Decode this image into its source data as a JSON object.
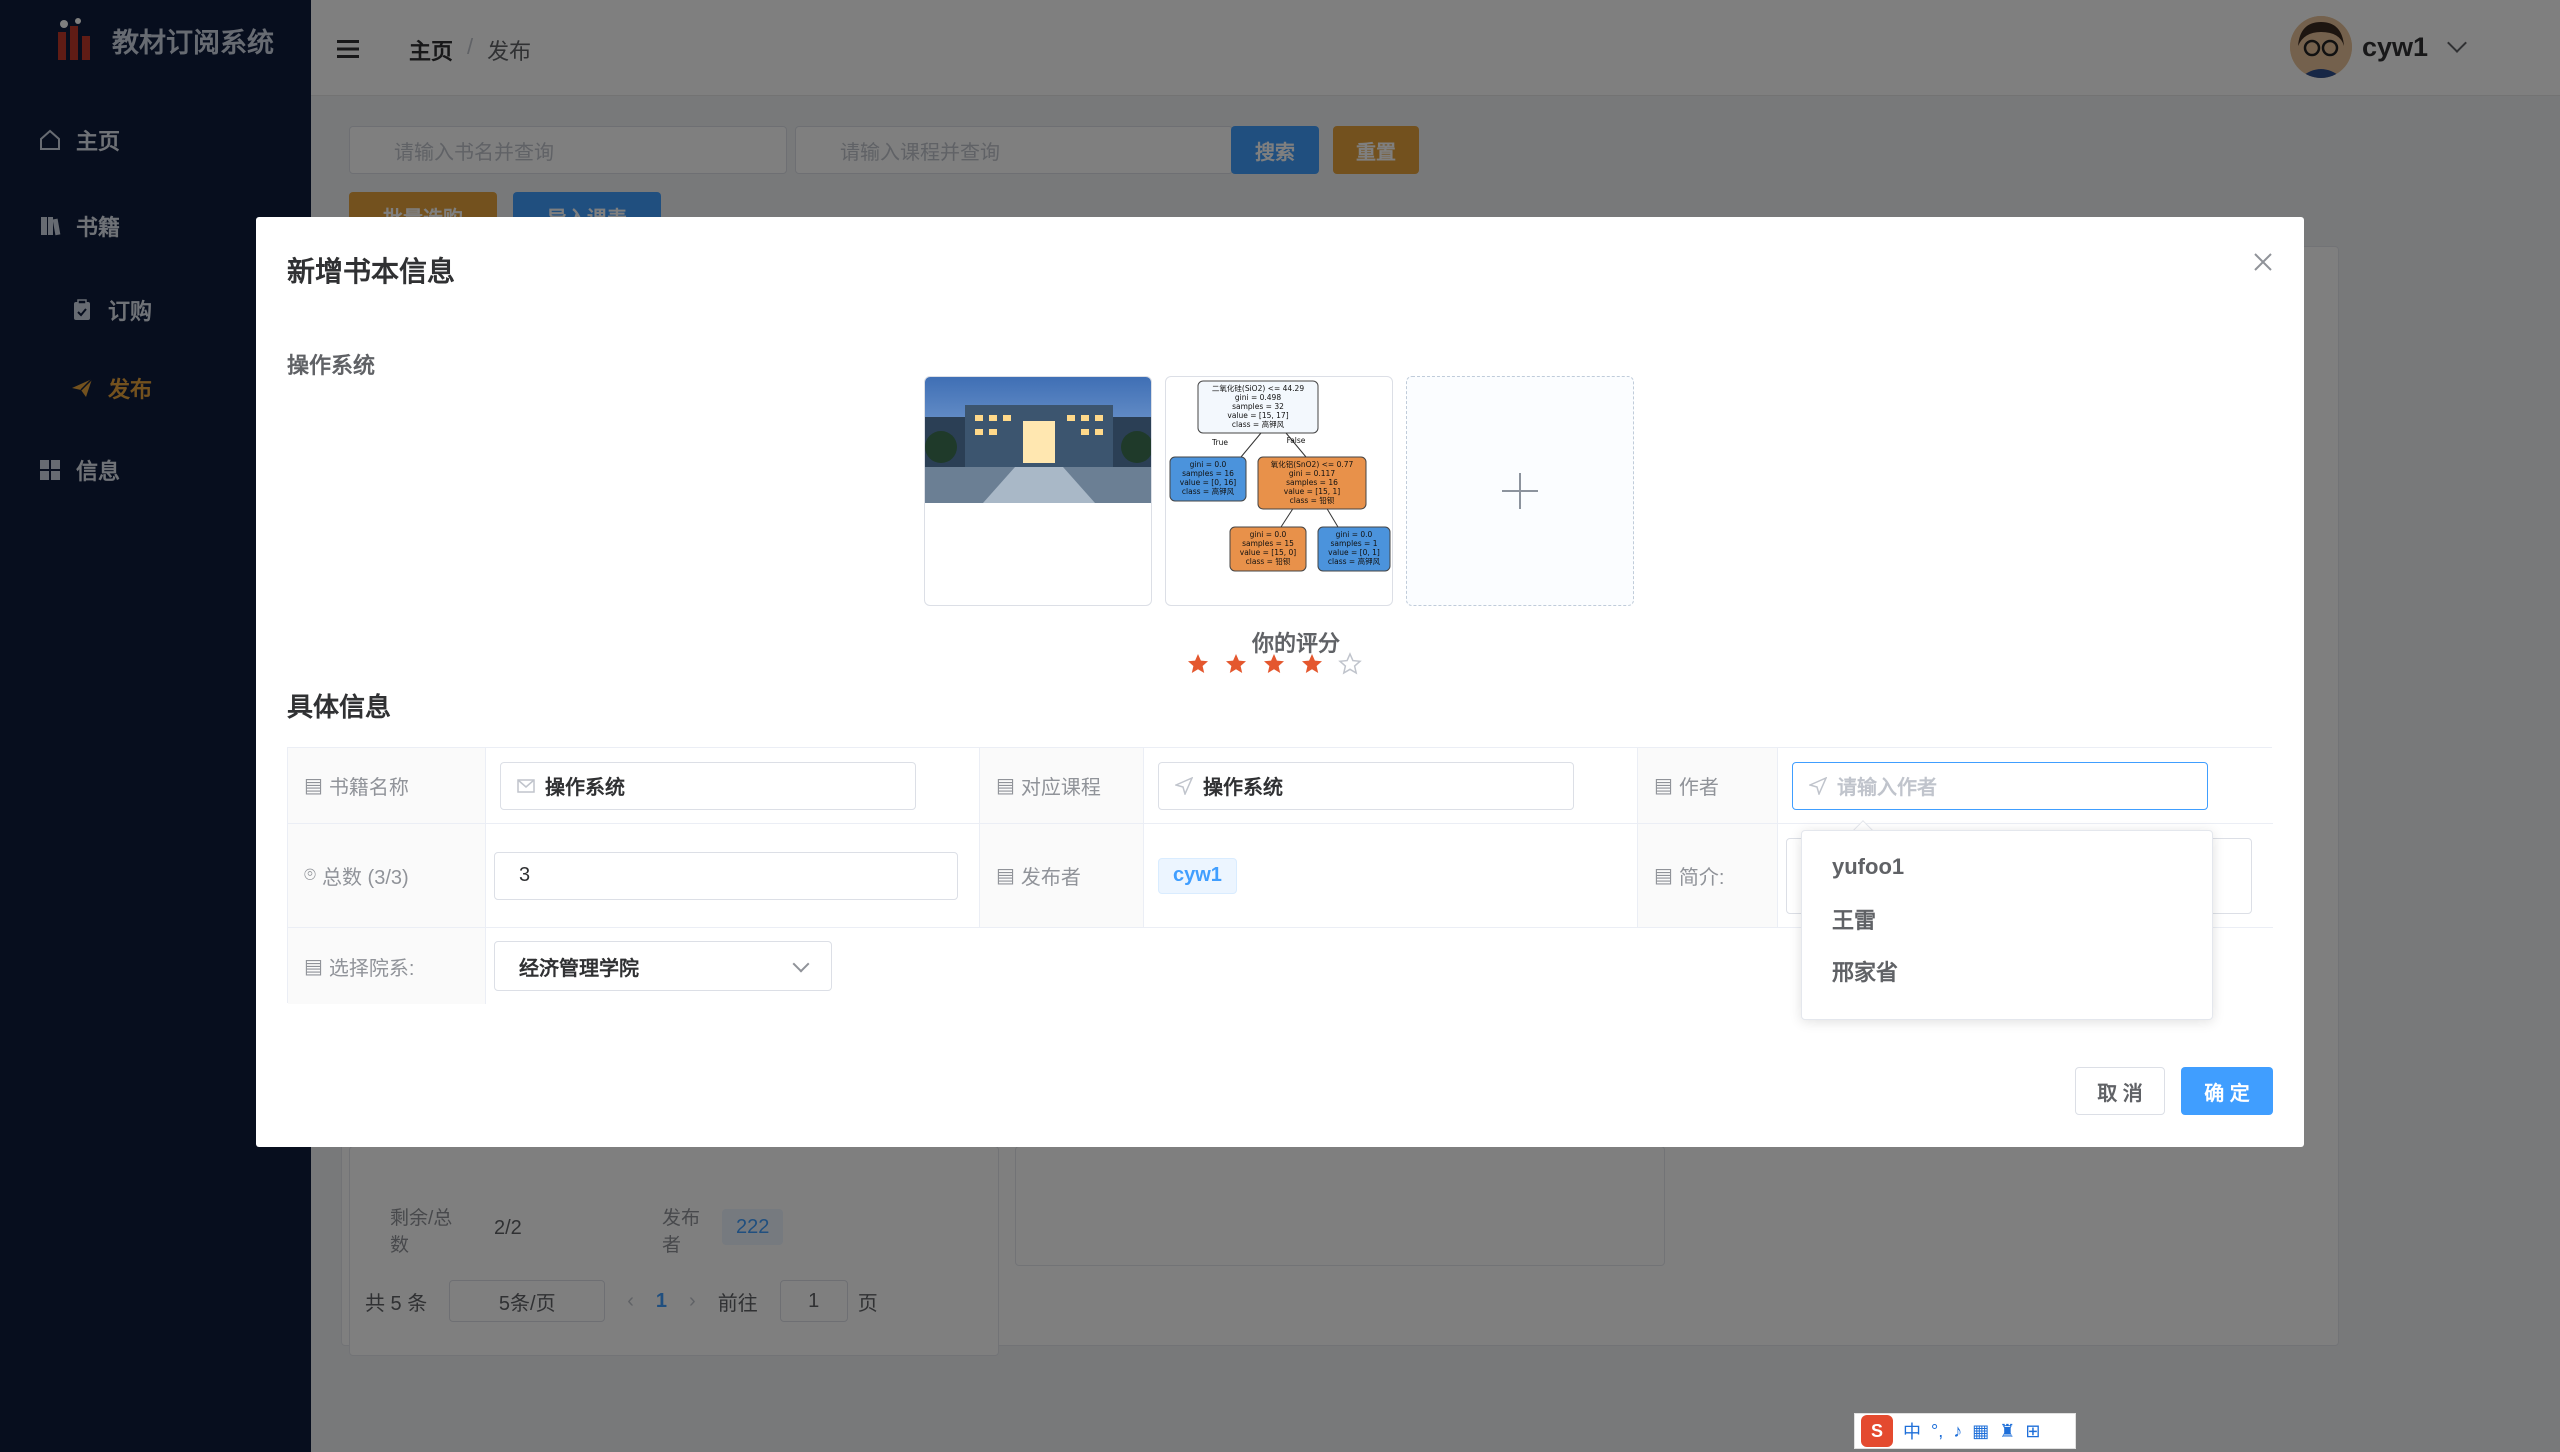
{
  "app": {
    "title": "教材订阅系统"
  },
  "sidebar": {
    "items": [
      {
        "label": "主页",
        "icon": "home-icon"
      },
      {
        "label": "书籍",
        "icon": "book-icon"
      },
      {
        "label": "订购",
        "icon": "clipboard-icon"
      },
      {
        "label": "发布",
        "icon": "paper-plane-icon",
        "active": true
      },
      {
        "label": "信息",
        "icon": "grid-icon"
      }
    ]
  },
  "header": {
    "breadcrumb": {
      "home": "主页",
      "separator": "/",
      "current": "发布"
    },
    "user": "cyw1"
  },
  "background": {
    "search_book_placeholder": "请输入书名并查询",
    "search_course_placeholder": "请输入课程并查询",
    "search_btn": "搜索",
    "reset_btn": "重置",
    "batch_btn": "批量选购",
    "import_btn": "导入课表",
    "card": {
      "remain_label": "剩余/总数",
      "remain_value": "2/2",
      "publisher_label": "发布者",
      "publisher_value": "222"
    },
    "pager": {
      "total": "共 5 条",
      "size": "5条/页",
      "page": "1",
      "goto": "前往",
      "goto_value": "1",
      "page_unit": "页"
    }
  },
  "dialog": {
    "title": "新增书本信息",
    "book_title": "操作系统",
    "rating_label": "你的评分",
    "rating": {
      "value": 4,
      "max": 5
    },
    "section_title": "具体信息",
    "fields": {
      "book_name_label": "书籍名称",
      "book_name_value": "操作系统",
      "course_label": "对应课程",
      "course_value": "操作系统",
      "author_label": "作者",
      "author_placeholder": "请输入作者",
      "total_label": "总数 (3/3)",
      "total_value": "3",
      "publisher_label": "发布者",
      "publisher_value": "cyw1",
      "intro_label": "简介:",
      "dept_label": "选择院系:",
      "dept_value": "经济管理学院"
    },
    "author_suggestions": [
      "yufoo1",
      "王雷",
      "邢家省"
    ],
    "cancel": "取 消",
    "confirm": "确 定"
  },
  "tree_image": {
    "root": [
      "二氧化硅(SiO2) <= 44.29",
      "gini = 0.498",
      "samples = 32",
      "value = [15, 17]",
      "class = 高钾风"
    ],
    "left": [
      "gini = 0.0",
      "samples = 16",
      "value = [0, 16]",
      "class = 高钾风"
    ],
    "right": [
      "氧化铝(SnO2) <= 0.77",
      "gini = 0.117",
      "samples = 16",
      "value = [15, 1]",
      "class = 铅钡"
    ],
    "rl": [
      "gini = 0.0",
      "samples = 15",
      "value = [15, 0]",
      "class = 铅钡"
    ],
    "rr": [
      "gini = 0.0",
      "samples = 1",
      "value = [0, 1]",
      "class = 高钾风"
    ],
    "true_label": "True",
    "false_label": "False"
  },
  "ime": {
    "lang": "中"
  },
  "colors": {
    "primary": "#409eff",
    "warning": "#e6a23c",
    "sidebar_bg": "#0f1d3d",
    "star": "#e4572e"
  }
}
